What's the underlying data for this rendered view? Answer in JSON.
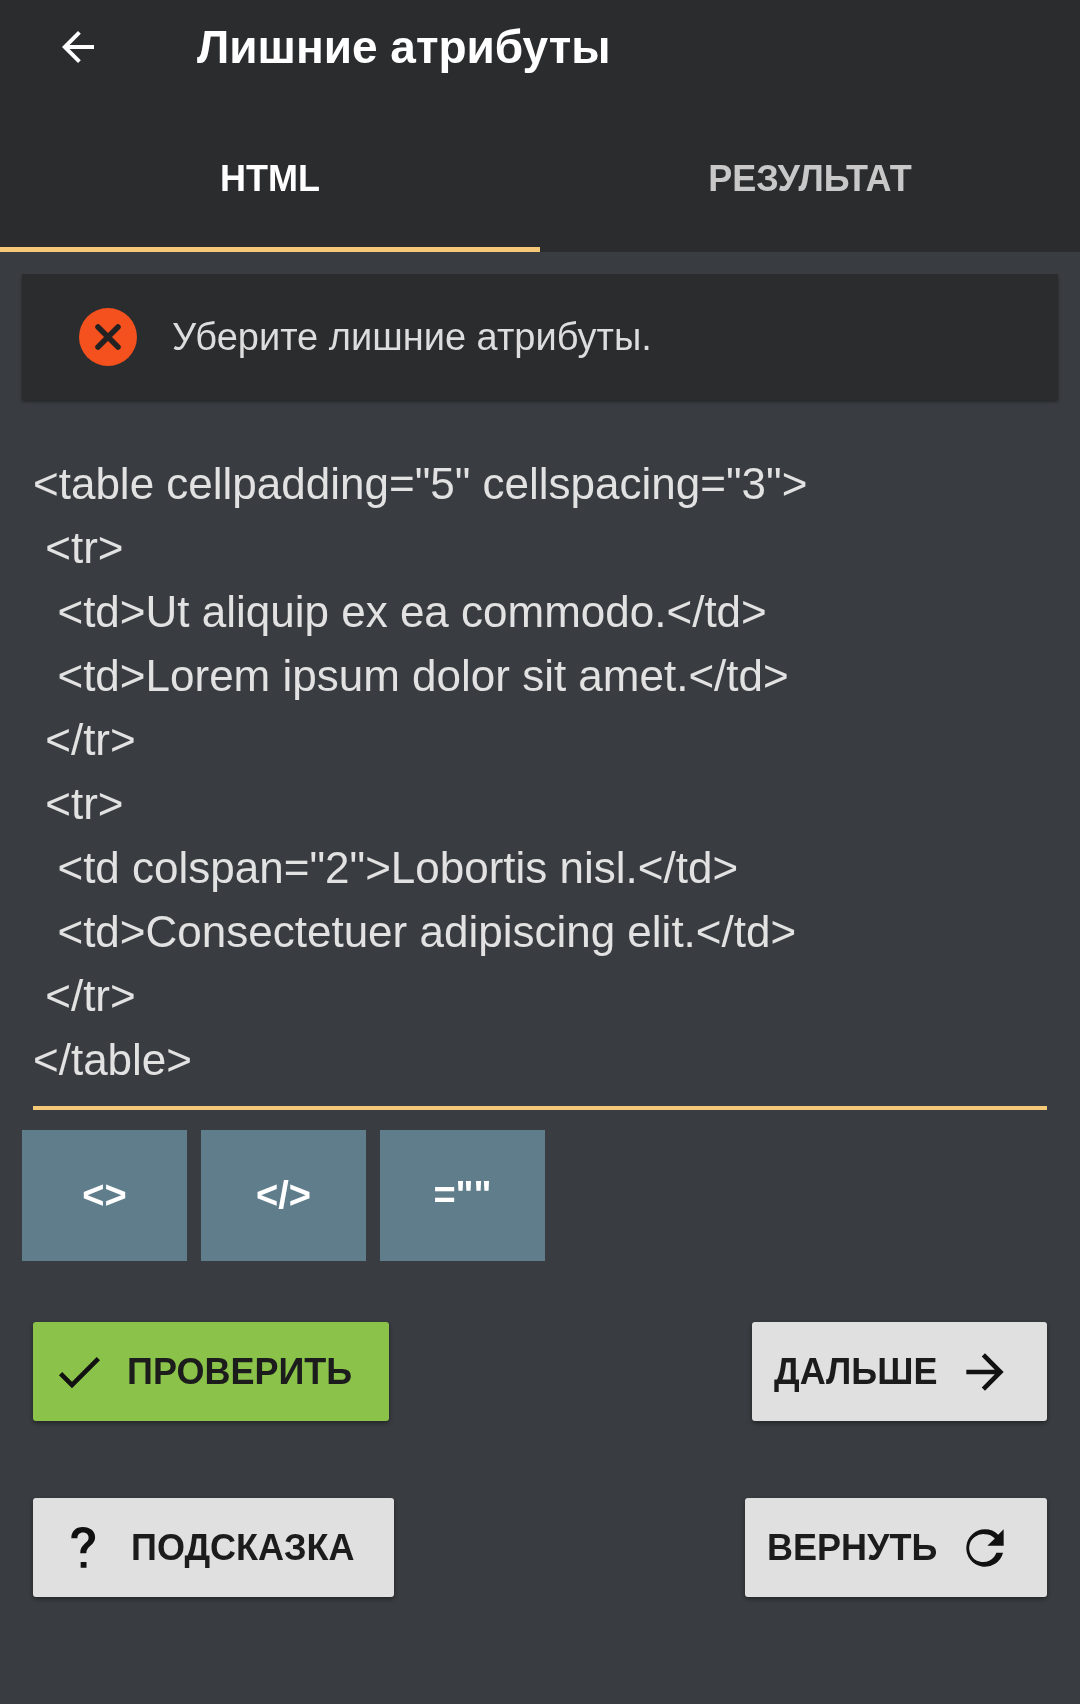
{
  "app_bar": {
    "title": "Лишние атрибуты"
  },
  "tabs": [
    {
      "label": "HTML",
      "selected": true
    },
    {
      "label": "РЕЗУЛЬТАТ",
      "selected": false
    }
  ],
  "message": {
    "kind": "error",
    "text": "Уберите лишние атрибуты."
  },
  "editor": {
    "value": "<table cellpadding=\"5\" cellspacing=\"3\">\n <tr>\n  <td>Ut aliquip ex ea commodo.</td>\n  <td>Lorem ipsum dolor sit amet.</td>\n </tr>\n <tr>\n  <td colspan=\"2\">Lobortis nisl.</td>\n  <td>Consectetuer adipiscing elit.</td>\n </tr>\n</table>"
  },
  "insert_buttons": [
    "<>",
    "</>",
    "=\"\""
  ],
  "actions": [
    {
      "kind": "check",
      "label": "ПРОВЕРИТЬ"
    },
    {
      "kind": "next",
      "label": "ДАЛЬШЕ"
    },
    {
      "kind": "hint",
      "label": "ПОДСКАЗКА"
    },
    {
      "kind": "reset",
      "label": "ВЕРНУТЬ"
    }
  ]
}
